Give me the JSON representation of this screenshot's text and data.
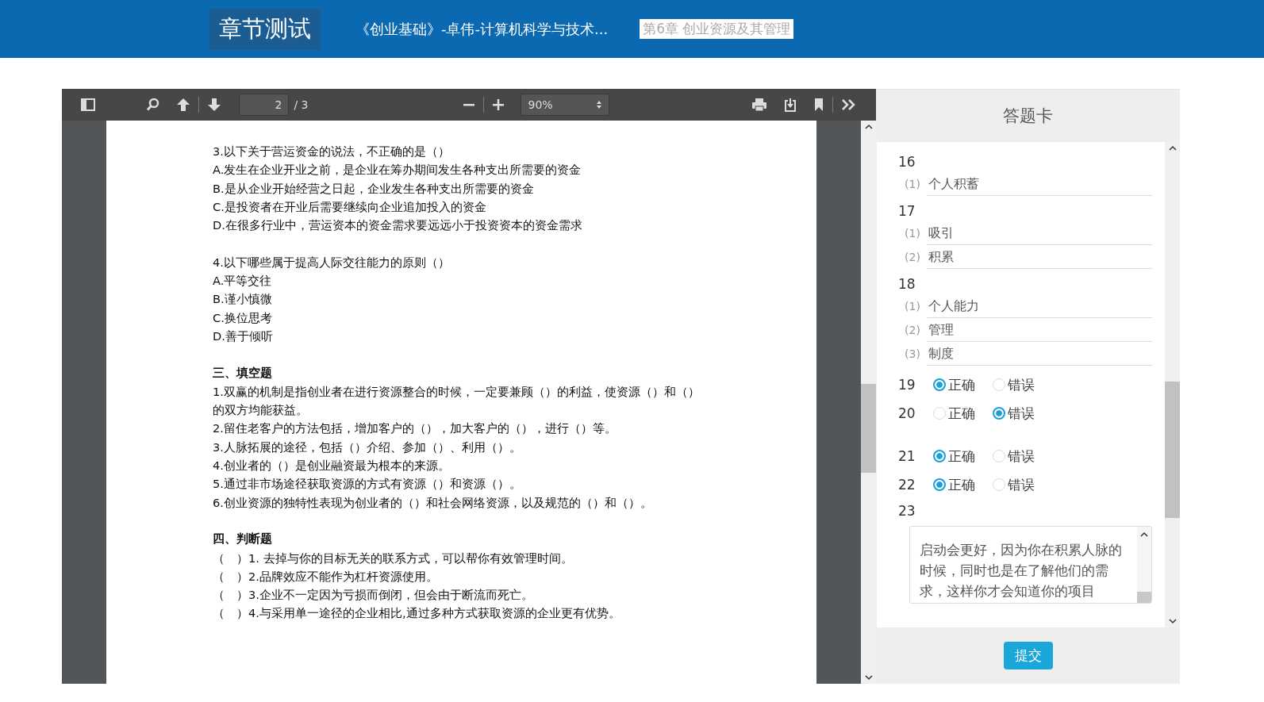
{
  "header": {
    "title": "章节测试",
    "course": "《创业基础》-卓伟-计算机科学与技术...",
    "chapter": "第6章 创业资源及其管理"
  },
  "viewer": {
    "toolbar": {
      "page": "2",
      "page_total": "/ 3",
      "zoom": "90%"
    },
    "blocks": [
      {
        "kind": "line",
        "text": "3.以下关于营运资金的说法，不正确的是（）"
      },
      {
        "kind": "line",
        "text": "A.发生在企业开业之前，是企业在筹办期间发生各种支出所需要的资金"
      },
      {
        "kind": "line",
        "text": "B.是从企业开始经营之日起，企业发生各种支出所需要的资金"
      },
      {
        "kind": "line",
        "text": "C.是投资者在开业后需要继续向企业追加投入的资金"
      },
      {
        "kind": "line",
        "text": "D.在很多行业中，营运资本的资金需求要远远小于投资资本的资金需求"
      },
      {
        "kind": "gap"
      },
      {
        "kind": "line",
        "text": "4.以下哪些属于提高人际交往能力的原则（）"
      },
      {
        "kind": "line",
        "text": "A.平等交往"
      },
      {
        "kind": "line",
        "text": "B.谨小慎微"
      },
      {
        "kind": "line",
        "text": "C.换位思考"
      },
      {
        "kind": "line",
        "text": "D.善于倾听"
      },
      {
        "kind": "gap"
      },
      {
        "kind": "heading",
        "text": "三、填空题"
      },
      {
        "kind": "line",
        "text": "1.双赢的机制是指创业者在进行资源整合的时候，一定要兼顾（）的利益，使资源（）和（）"
      },
      {
        "kind": "line",
        "text": "的双方均能获益。"
      },
      {
        "kind": "line",
        "text": "2.留住老客户的方法包括，增加客户的（），加大客户的（），进行（）等。"
      },
      {
        "kind": "line",
        "text": "3.人脉拓展的途径，包括（）介绍、参加（）、利用（）。"
      },
      {
        "kind": "line",
        "text": "4.创业者的（）是创业融资最为根本的来源。"
      },
      {
        "kind": "line",
        "text": "5.通过非市场途径获取资源的方式有资源（）和资源（）。"
      },
      {
        "kind": "line",
        "text": "6.创业资源的独特性表现为创业者的（）和社会网络资源，以及规范的（）和（）。"
      },
      {
        "kind": "gap"
      },
      {
        "kind": "heading",
        "text": "四、判断题"
      },
      {
        "kind": "line",
        "text": "（　）1. 去掉与你的目标无关的联系方式，可以帮你有效管理时间。"
      },
      {
        "kind": "line",
        "text": "（　）2.品牌效应不能作为杠杆资源使用。"
      },
      {
        "kind": "line",
        "text": "（　）3.企业不一定因为亏损而倒闭，但会由于断流而死亡。"
      },
      {
        "kind": "line",
        "text": "（　）4.与采用单一途径的企业相比,通过多种方式获取资源的企业更有优势。"
      }
    ]
  },
  "answer_card": {
    "title": "答题卡",
    "questions": [
      {
        "kind": "blanks",
        "number": "16",
        "blanks": [
          {
            "index": "(1)",
            "value": "个人积蓄"
          }
        ]
      },
      {
        "kind": "blanks",
        "number": "17",
        "blanks": [
          {
            "index": "(1)",
            "value": "吸引"
          },
          {
            "index": "(2)",
            "value": "积累"
          }
        ]
      },
      {
        "kind": "blanks",
        "number": "18",
        "blanks": [
          {
            "index": "(1)",
            "value": "个人能力"
          },
          {
            "index": "(2)",
            "value": "管理"
          },
          {
            "index": "(3)",
            "value": "制度"
          }
        ]
      },
      {
        "kind": "judge",
        "number": "19",
        "options": [
          {
            "label": "正确",
            "selected": true
          },
          {
            "label": "错误",
            "selected": false
          }
        ]
      },
      {
        "kind": "judge",
        "number": "20",
        "options": [
          {
            "label": "正确",
            "selected": false
          },
          {
            "label": "错误",
            "selected": true
          }
        ]
      },
      {
        "kind": "judge",
        "number": "21",
        "options": [
          {
            "label": "正确",
            "selected": true
          },
          {
            "label": "错误",
            "selected": false
          }
        ]
      },
      {
        "kind": "judge",
        "number": "22",
        "options": [
          {
            "label": "正确",
            "selected": true
          },
          {
            "label": "错误",
            "selected": false
          }
        ]
      },
      {
        "kind": "essay",
        "number": "23",
        "value": "启动会更好，因为你在积累人脉的时候，同时也是在了解他们的需求，这样你才会知道你的项目"
      }
    ],
    "submit": "提交"
  }
}
